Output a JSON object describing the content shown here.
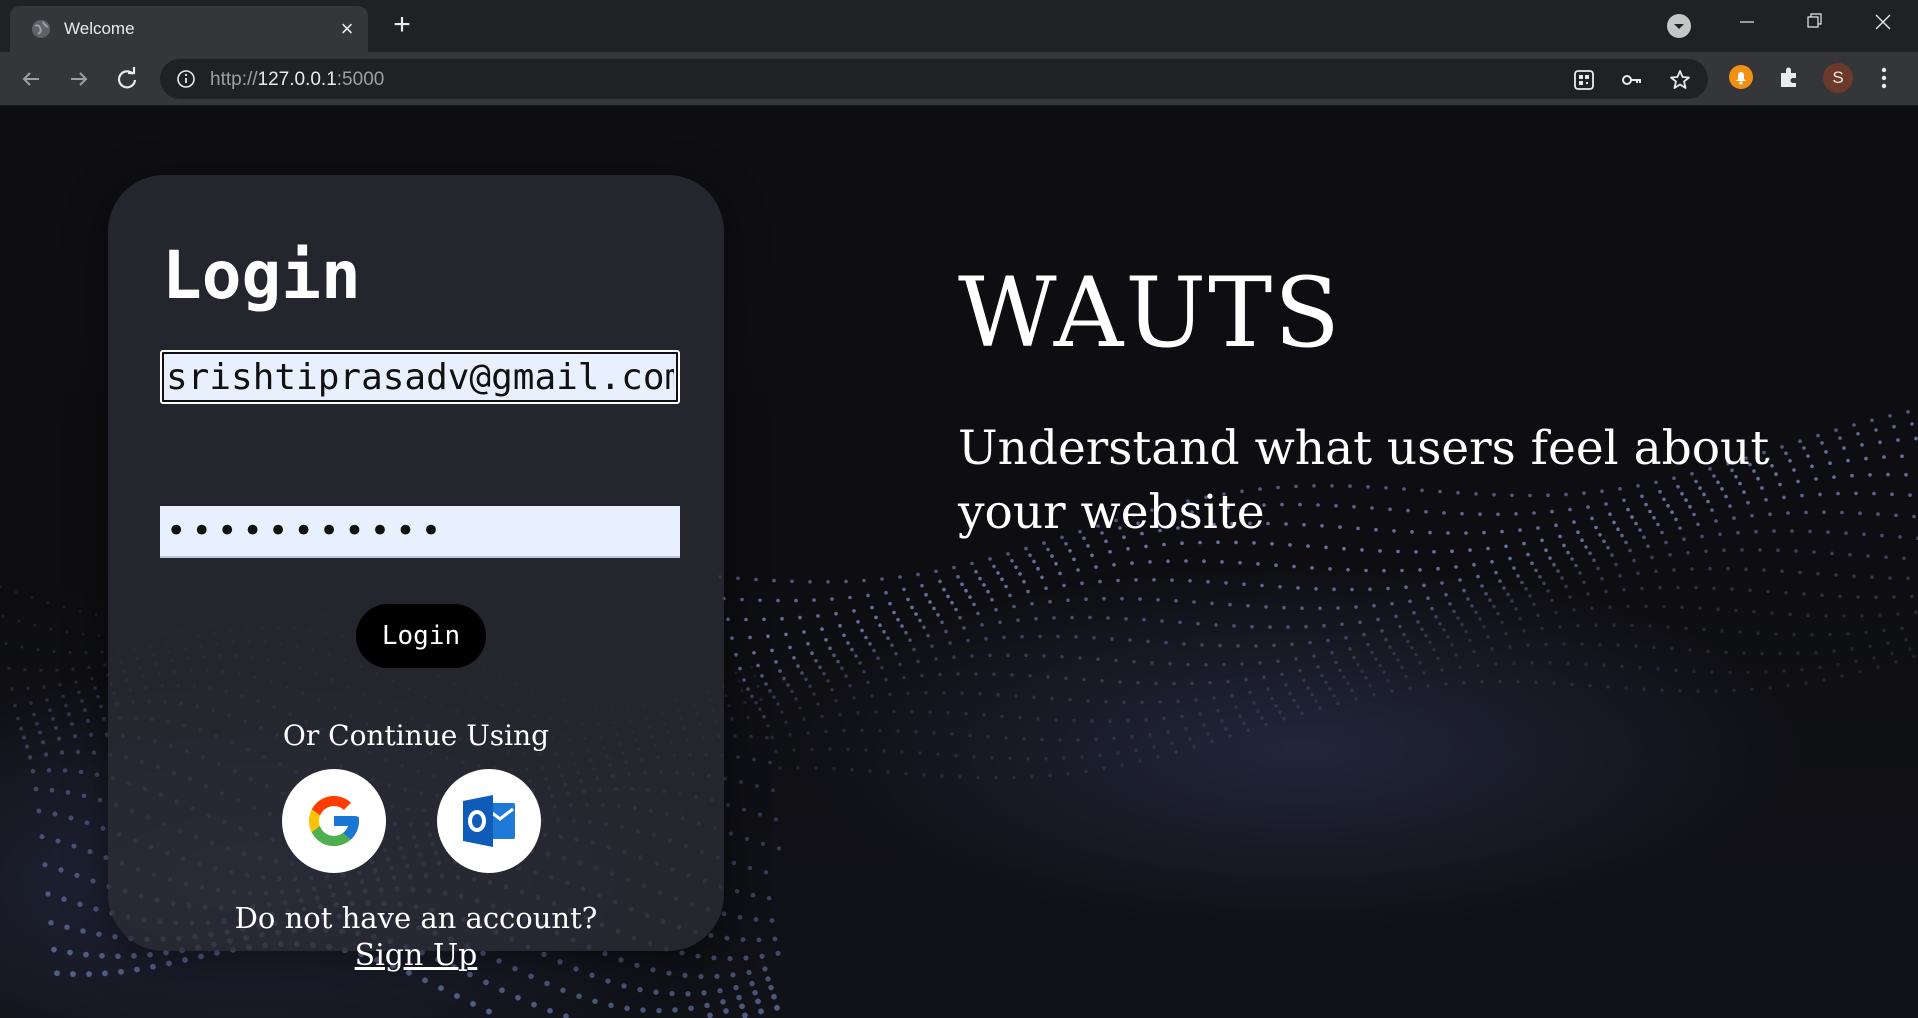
{
  "browser": {
    "tab_title": "Welcome",
    "url_prefix": "http://",
    "url_host": "127.0.0.1",
    "url_port": ":5000",
    "avatar_letter": "S",
    "icons": [
      "globe-icon",
      "close-icon",
      "plus-icon",
      "tab-search-icon",
      "minimize-icon",
      "restore-icon",
      "window-close-icon",
      "back-icon",
      "forward-icon",
      "reload-icon",
      "info-icon",
      "qr-code-icon",
      "key-icon",
      "star-icon",
      "extension-bell-icon",
      "puzzle-icon",
      "kebab-menu-icon"
    ]
  },
  "login": {
    "title": "Login",
    "email_value": "srishtiprasadv@gmail.com",
    "password_value": "•••••••••••",
    "button_label": "Login",
    "continue_text": "Or Continue Using",
    "no_account_text": "Do not have an account?",
    "signup_label": "Sign Up"
  },
  "hero": {
    "title": "WAUTS",
    "subtitle": "Understand what users feel about your website"
  },
  "colors": {
    "page_bg": "#0e0e12",
    "card_bg": "#2c2c34",
    "input_bg": "#e8f0fe",
    "accent_wave": "#8a9ce0"
  }
}
